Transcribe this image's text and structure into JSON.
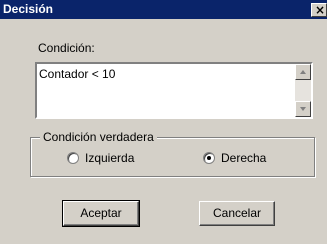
{
  "window": {
    "title": "Decisión",
    "close_glyph": "×"
  },
  "condition": {
    "label": "Condición:",
    "value": "Contador < 10"
  },
  "group": {
    "legend": "Condición verdadera",
    "options": [
      {
        "label": "Izquierda",
        "selected": false
      },
      {
        "label": "Derecha",
        "selected": true
      }
    ]
  },
  "buttons": {
    "accept": "Aceptar",
    "cancel": "Cancelar"
  },
  "icons": {
    "close": "close-icon",
    "scroll_up": "arrow-up-icon",
    "scroll_down": "arrow-down-icon"
  },
  "colors": {
    "titlebar": "#0a246a",
    "face": "#d4d0c8"
  }
}
